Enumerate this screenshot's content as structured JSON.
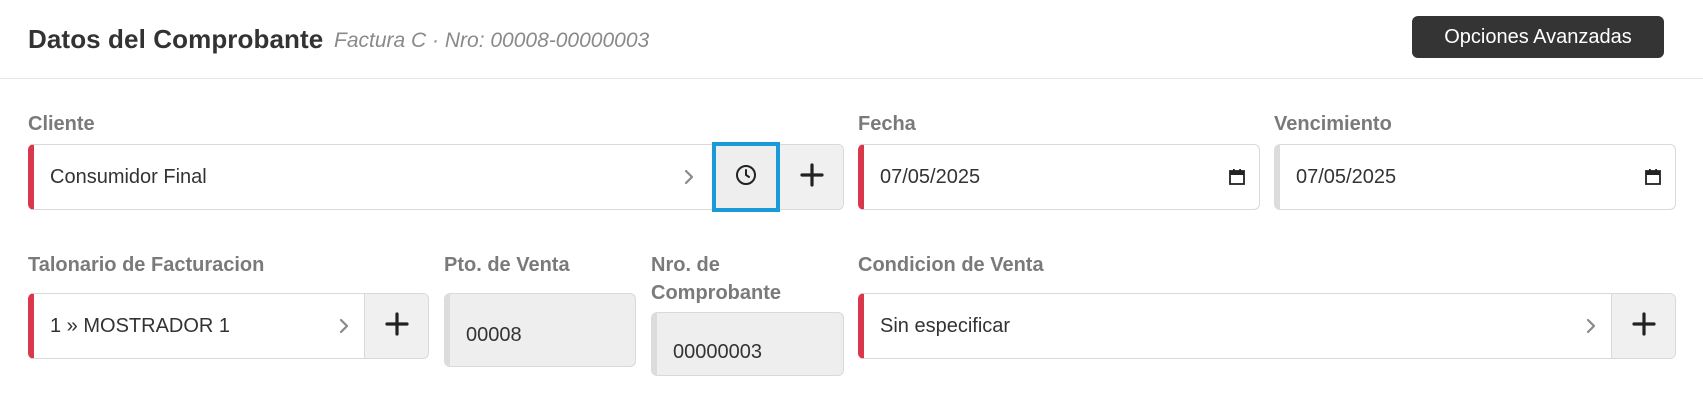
{
  "header": {
    "title": "Datos del Comprobante",
    "subtitle": "Factura C · Nro: 00008-00000003",
    "advanced_button": "Opciones Avanzadas"
  },
  "cliente": {
    "label": "Cliente",
    "value": "Consumidor Final",
    "icons": [
      "chevron-right-icon",
      "clock-icon",
      "plus-icon"
    ]
  },
  "fecha": {
    "label": "Fecha",
    "value": "07/05/2025",
    "icon": "calendar-icon"
  },
  "vencimiento": {
    "label": "Vencimiento",
    "value": "07/05/2025",
    "icon": "calendar-icon"
  },
  "talonario": {
    "label": "Talonario de Facturacion",
    "value": "1 » MOSTRADOR 1",
    "icons": [
      "chevron-right-icon",
      "plus-icon"
    ]
  },
  "pto_venta": {
    "label": "Pto. de Venta",
    "value": "00008"
  },
  "nro_comprobante": {
    "label_line1": "Nro. de",
    "label_line2": "Comprobante",
    "value": "00000003"
  },
  "condicion": {
    "label": "Condicion de Venta",
    "value": "Sin especificar",
    "icons": [
      "chevron-right-icon",
      "plus-icon"
    ]
  },
  "colors": {
    "required_accent": "#d9374b",
    "focus_ring": "#1a9ad6",
    "dark_button": "#343434"
  }
}
